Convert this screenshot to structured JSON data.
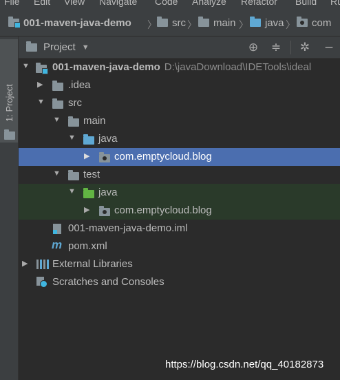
{
  "menu": {
    "items": [
      "File",
      "Edit",
      "View",
      "Navigate",
      "Code",
      "Analyze",
      "Refactor",
      "Build",
      "Ru"
    ]
  },
  "breadcrumbs": [
    "001-maven-java-demo",
    "src",
    "main",
    "java",
    "com"
  ],
  "sidebar": {
    "tab_label": "1: Project"
  },
  "panel": {
    "title": "Project",
    "view_dropdown_icon": "chevron-down-icon"
  },
  "header_actions": [
    "locate-icon",
    "collapse-all-icon",
    "settings-icon",
    "hide-icon"
  ],
  "tree": [
    {
      "label": "001-maven-java-demo",
      "path": "D:\\javaDownload\\IDETools\\ideal",
      "expanded": true,
      "icon": "module-folder-icon"
    },
    {
      "label": ".idea",
      "expanded": false,
      "icon": "folder-icon"
    },
    {
      "label": "src",
      "expanded": true,
      "icon": "folder-icon"
    },
    {
      "label": "main",
      "expanded": true,
      "icon": "folder-icon"
    },
    {
      "label": "java",
      "expanded": true,
      "icon": "source-folder-icon"
    },
    {
      "label": "com.emptycloud.blog",
      "expanded": false,
      "icon": "package-icon",
      "selected": true
    },
    {
      "label": "test",
      "expanded": true,
      "icon": "folder-icon"
    },
    {
      "label": "java",
      "expanded": true,
      "icon": "test-source-folder-icon"
    },
    {
      "label": "com.emptycloud.blog",
      "expanded": false,
      "icon": "package-icon"
    },
    {
      "label": "001-maven-java-demo.iml",
      "icon": "iml-file-icon"
    },
    {
      "label": "pom.xml",
      "icon": "maven-icon"
    },
    {
      "label": "External Libraries",
      "expanded": false,
      "icon": "libraries-icon"
    },
    {
      "label": "Scratches and Consoles",
      "icon": "scratches-icon"
    }
  ],
  "watermark": "https://blog.csdn.net/qq_40182873",
  "colors": {
    "background": "#2b2b2b",
    "chrome": "#3c3f41",
    "selection": "#4b6eaf",
    "test_row": "#2a3a2a",
    "source_folder": "#5fa8d3",
    "test_folder": "#62b543"
  }
}
